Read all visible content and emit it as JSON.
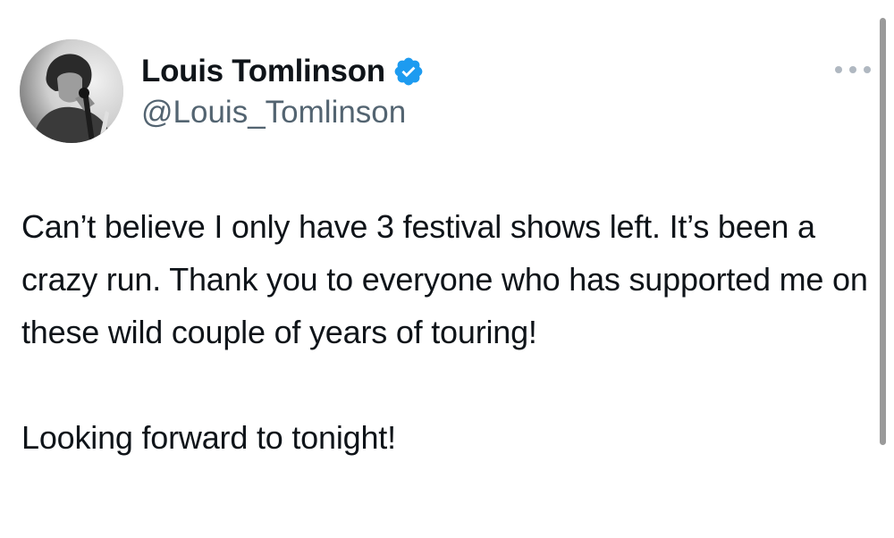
{
  "author": {
    "name": "Louis Tomlinson",
    "handle": "@Louis_Tomlinson",
    "verified": true,
    "badge_color": "#1d9bf0",
    "avatar": "profile-photo"
  },
  "tweet": {
    "paragraph_1": "Can’t believe I only have 3 festival shows left. It’s been a crazy run. Thank you to everyone who has supported me on these wild couple of years of touring!",
    "paragraph_2": "Looking forward to tonight!"
  },
  "actions": {
    "more_icon": "more-horizontal-icon"
  },
  "colors": {
    "text": "#0f1419",
    "secondary_text": "#536471",
    "background": "#ffffff"
  }
}
